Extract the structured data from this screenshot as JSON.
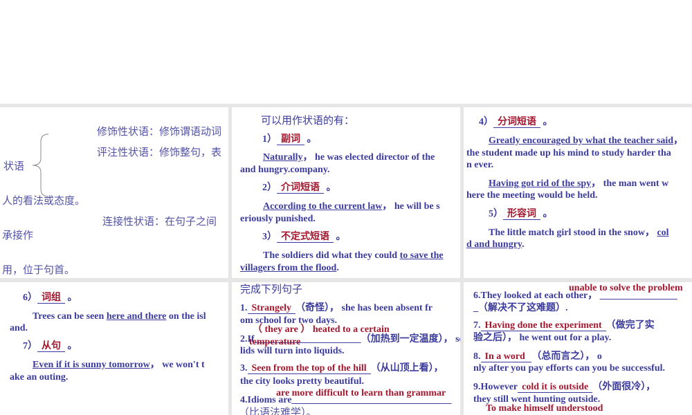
{
  "panel1": {
    "label": "状语",
    "lines": [
      [
        {
          "t": "修饰性状语：修饰谓语动词"
        }
      ],
      [
        {
          "t": "评注性状语：修饰整句，表"
        }
      ],
      [
        {
          "t": "人的看法或态度。"
        }
      ],
      [
        {
          "t": "连接性状语：在句子之间"
        }
      ],
      [
        {
          "t": "承接作"
        }
      ],
      [
        {
          "t": "用，位于句首。"
        }
      ]
    ]
  },
  "panel2": {
    "lines": [
      [
        {
          "t": "可以用作状语的有："
        }
      ],
      [
        {
          "t": "1）"
        },
        {
          "t": "副词",
          "s": "r"
        },
        {
          "t": " 。"
        }
      ],
      [
        {
          "t": "Naturally",
          "s": "u"
        },
        {
          "t": "，  he was elected director of the"
        }
      ],
      [
        {
          "t": "and hungry.company."
        }
      ],
      [
        {
          "t": "2）"
        },
        {
          "t": "介词短语",
          "s": "r"
        },
        {
          "t": " 。"
        }
      ],
      [
        {
          "t": "According to the current law",
          "s": "u"
        },
        {
          "t": "，  he will be s"
        }
      ],
      [
        {
          "t": "eriously punished."
        }
      ],
      [
        {
          "t": "3）"
        },
        {
          "t": "不定式短语",
          "s": "r"
        },
        {
          "t": " 。"
        }
      ],
      [
        {
          "t": "The soldiers did what they could "
        },
        {
          "t": "to save the",
          "s": "u"
        }
      ],
      [
        {
          "t": "villagers from the flood",
          "s": "u"
        },
        {
          "t": "."
        }
      ]
    ]
  },
  "panel3": {
    "lines": [
      [
        {
          "t": "4）"
        },
        {
          "t": "分词短语",
          "s": "r"
        },
        {
          "t": " 。"
        }
      ],
      [
        {
          "t": "Greatly encouraged by what the teacher said",
          "s": "u"
        },
        {
          "t": "，"
        }
      ],
      [
        {
          "t": "the student made up his mind to study harder tha"
        }
      ],
      [
        {
          "t": "n ever."
        }
      ],
      [
        {
          "t": "Having got rid of the spy",
          "s": "u"
        },
        {
          "t": "，  the man went w"
        }
      ],
      [
        {
          "t": "here the meeting would be held."
        }
      ],
      [
        {
          "t": "5）"
        },
        {
          "t": "形容词",
          "s": "r"
        },
        {
          "t": " 。"
        }
      ],
      [
        {
          "t": "The little match girl stood in the snow，  "
        },
        {
          "t": "col",
          "s": "u"
        }
      ],
      [
        {
          "t": "d and hungry",
          "s": "u"
        },
        {
          "t": "."
        }
      ]
    ]
  },
  "panel4": {
    "lines": [
      [
        {
          "t": "6）"
        },
        {
          "t": "词组",
          "s": "r"
        },
        {
          "t": " 。"
        }
      ],
      [
        {
          "t": "Trees can be seen "
        },
        {
          "t": "here and there",
          "s": "u"
        },
        {
          "t": " on the isl"
        }
      ],
      [
        {
          "t": "and."
        }
      ],
      [
        {
          "t": "7）"
        },
        {
          "t": "从句",
          "s": "r"
        },
        {
          "t": " 。"
        }
      ],
      [
        {
          "t": "Even if it is sunny tomorrow",
          "s": "u"
        },
        {
          "t": "，  we won't t"
        }
      ],
      [
        {
          "t": "ake an outing."
        }
      ]
    ]
  },
  "panel5": {
    "lines": [
      [
        {
          "t": "完成下列句子"
        }
      ],
      [
        {
          "t": "1."
        },
        {
          "t": "Strangely",
          "s": "r"
        },
        {
          "t": "（奇怪）， she has been absent fr"
        }
      ],
      [
        {
          "t": "om school for two days."
        }
      ],
      [
        {
          "t": "（ they are ）  heated to a certain",
          "s": "rn"
        }
      ],
      [
        {
          "t": "2.If______________________（加热到一定温度）， so"
        }
      ],
      [
        {
          "t": "temperature",
          "s": "rn"
        }
      ],
      [
        {
          "t": "lids will turn into liquids."
        }
      ],
      [
        {
          "t": "3."
        },
        {
          "t": "Seen from the top of the hill",
          "s": "r"
        },
        {
          "t": "（从山顶上看），"
        }
      ],
      [
        {
          "t": "the city looks pretty beautiful."
        }
      ],
      [
        {
          "t": "are more difficult to learn than grammar",
          "s": "rn"
        }
      ],
      [
        {
          "t": "4.Idioms are_________________________________"
        }
      ],
      [
        {
          "t": "（比语法难学）。"
        }
      ]
    ]
  },
  "panel6": {
    "lines": [
      [
        {
          "t": "unable to solve the problem",
          "s": "rn"
        }
      ],
      [
        {
          "t": "6.They looked at each other，  ________________"
        }
      ],
      [
        {
          "t": "_（解决不了这难题）."
        }
      ],
      [
        {
          "t": "7."
        },
        {
          "t": "Having done the experiment",
          "s": "r"
        },
        {
          "t": "（做完了实"
        }
      ],
      [
        {
          "t": "验之后）， he went out for a play."
        }
      ],
      [
        {
          "t": "8."
        },
        {
          "t": "In a word                  ",
          "s": "r"
        },
        {
          "t": "（总而言之）， o"
        }
      ],
      [
        {
          "t": "nly after you pay efforts can you be successful."
        }
      ],
      [
        {
          "t": "9.However"
        },
        {
          "t": "cold it is outside",
          "s": "r"
        },
        {
          "t": "（外面很冷），"
        }
      ],
      [
        {
          "t": "they still went hunting outside."
        }
      ],
      [
        {
          "t": "To make himself understood",
          "s": "rn"
        }
      ]
    ]
  }
}
